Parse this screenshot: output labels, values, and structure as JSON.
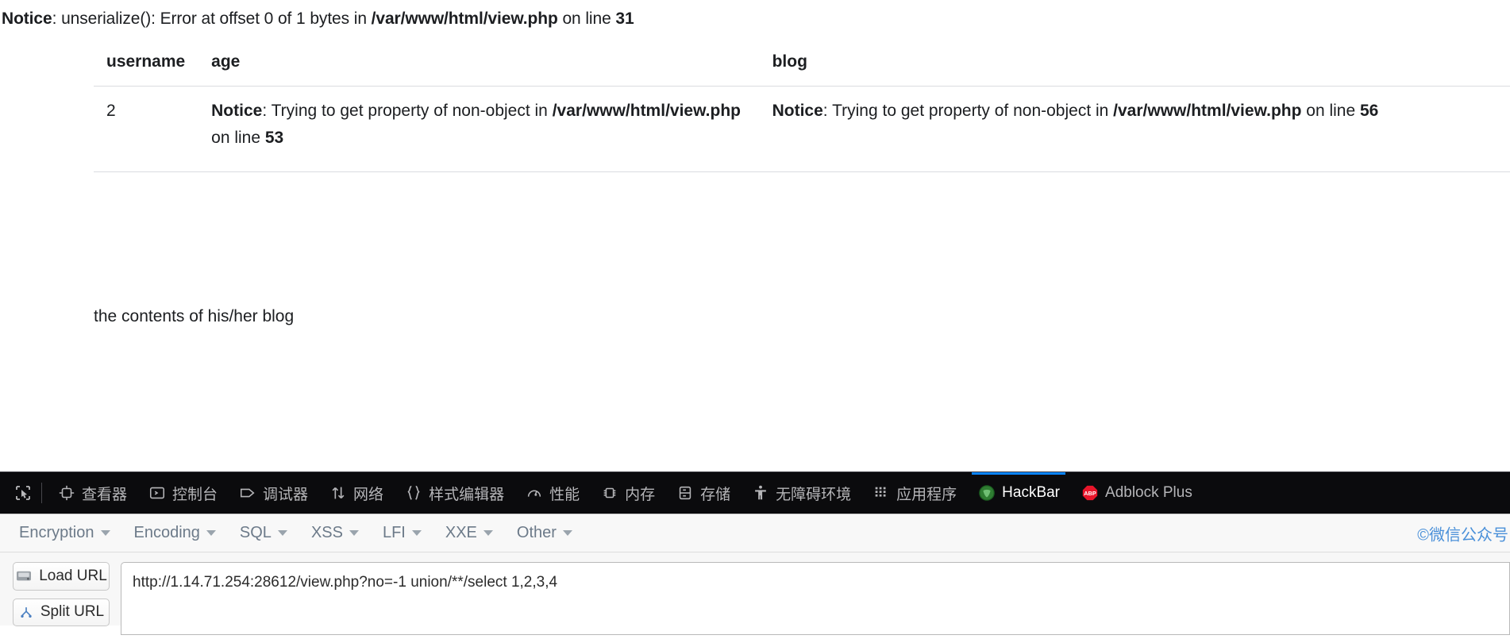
{
  "page": {
    "top_notice": {
      "label": "Notice",
      "text_1": ": unserialize(): Error at offset 0 of 1 bytes in ",
      "path": "/var/www/html/view.php",
      "text_2": " on line ",
      "line": "31"
    },
    "table": {
      "headers": [
        "username",
        "age",
        "blog"
      ],
      "rows": [
        {
          "username": "2",
          "age": {
            "label": "Notice",
            "text_1": ": Trying to get property of non-object in ",
            "path": "/var/www/html/view.php",
            "text_2": " on line ",
            "line": "53"
          },
          "blog": {
            "label": "Notice",
            "text_1": ": Trying to get property of non-object in ",
            "path": "/var/www/html/view.php",
            "text_2": " on line ",
            "line": "56"
          }
        }
      ]
    },
    "footer_text": "the contents of his/her blog"
  },
  "devtools": {
    "picker_icon": "element-picker-icon",
    "tabs": [
      {
        "label": "查看器",
        "icon": "inspector-icon",
        "active": false
      },
      {
        "label": "控制台",
        "icon": "console-icon",
        "active": false
      },
      {
        "label": "调试器",
        "icon": "debugger-icon",
        "active": false
      },
      {
        "label": "网络",
        "icon": "network-icon",
        "active": false
      },
      {
        "label": "样式编辑器",
        "icon": "style-editor-icon",
        "active": false
      },
      {
        "label": "性能",
        "icon": "performance-icon",
        "active": false
      },
      {
        "label": "内存",
        "icon": "memory-icon",
        "active": false
      },
      {
        "label": "存储",
        "icon": "storage-icon",
        "active": false
      },
      {
        "label": "无障碍环境",
        "icon": "accessibility-icon",
        "active": false
      },
      {
        "label": "应用程序",
        "icon": "application-icon",
        "active": false
      },
      {
        "label": "HackBar",
        "icon": "hackbar-icon",
        "active": true
      },
      {
        "label": "Adblock Plus",
        "icon": "adblock-plus-icon",
        "active": false
      }
    ],
    "active_tab_accent": "#0a84ff"
  },
  "hackbar": {
    "menus": [
      {
        "label": "Encryption"
      },
      {
        "label": "Encoding"
      },
      {
        "label": "SQL"
      },
      {
        "label": "XSS"
      },
      {
        "label": "LFI"
      },
      {
        "label": "XXE"
      },
      {
        "label": "Other"
      }
    ],
    "watermark": "©微信公众号",
    "buttons": [
      {
        "label": "Load URL",
        "icon": "load-url-icon"
      },
      {
        "label": "Split URL",
        "icon": "split-url-icon"
      }
    ],
    "url_value": "http://1.14.71.254:28612/view.php?no=-1 union/**/select 1,2,3,4"
  }
}
